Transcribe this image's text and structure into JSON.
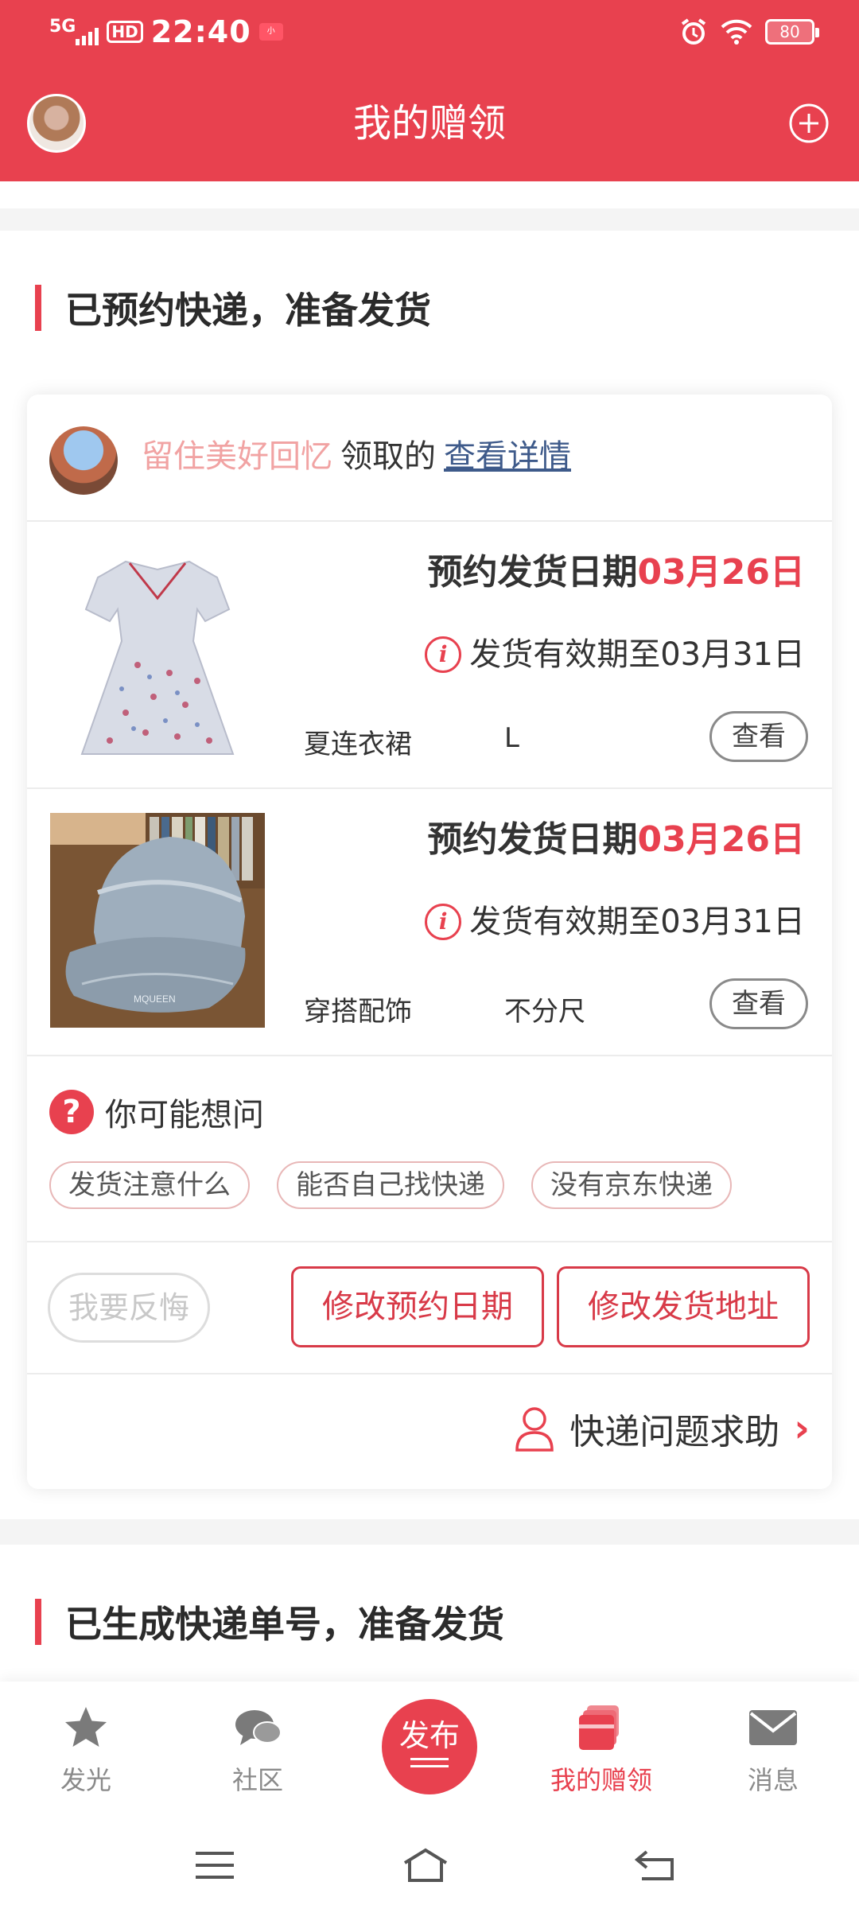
{
  "status_bar": {
    "network": "5G",
    "hd": "HD",
    "time": "22:40",
    "battery": "80"
  },
  "header": {
    "title": "我的赠领"
  },
  "section1": {
    "title": "已预约快递，准备发货"
  },
  "card": {
    "user_name": "留住美好回忆",
    "action_text": "领取的",
    "detail_link": "查看详情",
    "items": [
      {
        "date_prefix": "预约发货日期",
        "date_value": "03月26日",
        "valid_text": "发货有效期至03月31日",
        "category": "夏连衣裙",
        "size": "L",
        "view_label": "查看",
        "image": "dress"
      },
      {
        "date_prefix": "预约发货日期",
        "date_value": "03月26日",
        "valid_text": "发货有效期至03月31日",
        "category": "穿搭配饰",
        "size": "不分尺",
        "view_label": "查看",
        "image": "cap"
      }
    ],
    "faq": {
      "title": "你可能想问",
      "chips": [
        "发货注意什么",
        "能否自己找快递",
        "没有京东快递"
      ]
    },
    "actions": {
      "regret": "我要反悔",
      "change_date": "修改预约日期",
      "change_address": "修改发货地址"
    },
    "help": "快递问题求助"
  },
  "section2": {
    "title": "已生成快递单号，准备发货"
  },
  "tabbar": {
    "tabs": [
      {
        "label": "发光",
        "icon": "star-icon"
      },
      {
        "label": "社区",
        "icon": "chat-icon"
      },
      {
        "label": "我的赠领",
        "icon": "gift-box-icon",
        "active": true
      },
      {
        "label": "消息",
        "icon": "mail-icon"
      }
    ],
    "publish": "发布"
  },
  "colors": {
    "brand": "#e8414f",
    "link": "#3e5a8a",
    "user_name": "#f1a3a3"
  }
}
